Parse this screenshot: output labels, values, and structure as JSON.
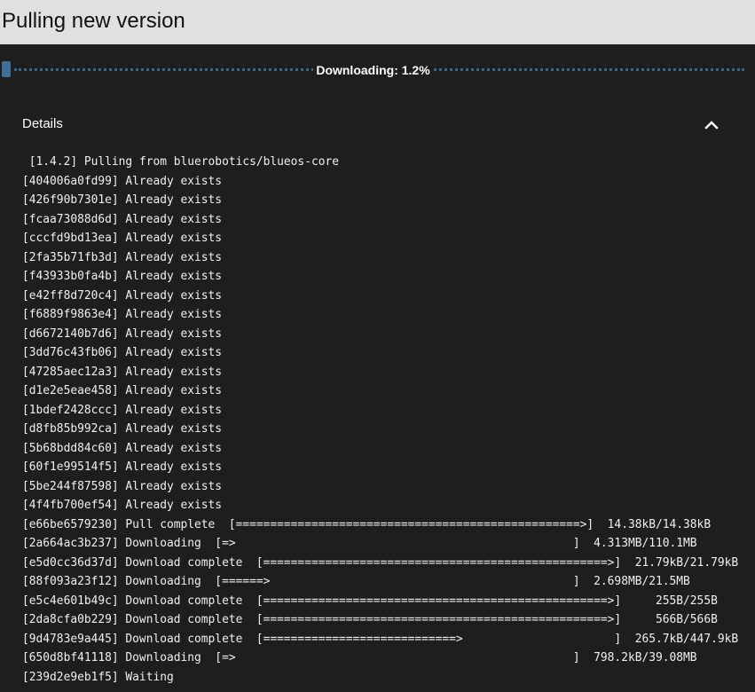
{
  "header": {
    "title": "Pulling new version"
  },
  "progress": {
    "label": "Downloading: 1.2%",
    "percent": 1.2
  },
  "details": {
    "title": "Details",
    "expanded": true,
    "toggle_icon": "chevron-up-icon",
    "log_lines": [
      " [1.4.2] Pulling from bluerobotics/blueos-core",
      "[404006a0fd99] Already exists",
      "[426f90b7301e] Already exists",
      "[fcaa73088d6d] Already exists",
      "[cccfd9bd13ea] Already exists",
      "[2fa35b71fb3d] Already exists",
      "[f43933b0fa4b] Already exists",
      "[e42ff8d720c4] Already exists",
      "[f6889f9863e4] Already exists",
      "[d6672140b7d6] Already exists",
      "[3dd76c43fb06] Already exists",
      "[47285aec12a3] Already exists",
      "[d1e2e5eae458] Already exists",
      "[1bdef2428ccc] Already exists",
      "[d8fb85b992ca] Already exists",
      "[5b68bdd84c60] Already exists",
      "[60f1e99514f5] Already exists",
      "[5be244f87598] Already exists",
      "[4f4fb700ef54] Already exists",
      "[e66be6579230] Pull complete  [==================================================>]  14.38kB/14.38kB",
      "[2a664ac3b237] Downloading  [=>                                                 ]  4.313MB/110.1MB",
      "[e5d0cc36d37d] Download complete  [==================================================>]  21.79kB/21.79kB",
      "[88f093a23f12] Downloading  [======>                                            ]  2.698MB/21.5MB",
      "[e5c4e601b49c] Download complete  [==================================================>]     255B/255B",
      "[2da8cfa0b229] Download complete  [==================================================>]     566B/566B",
      "[9d4783e9a445] Download complete  [============================>                      ]  265.7kB/447.9kB",
      "[650d8bf41118] Downloading  [=>                                                 ]  798.2kB/39.08MB",
      "[239d2e9eb1f5] Waiting"
    ]
  },
  "colors": {
    "title_bar": "#e0e0e0",
    "background": "#1e1e1e",
    "progress_accent": "#3f6f97",
    "text": "#ffffff"
  }
}
